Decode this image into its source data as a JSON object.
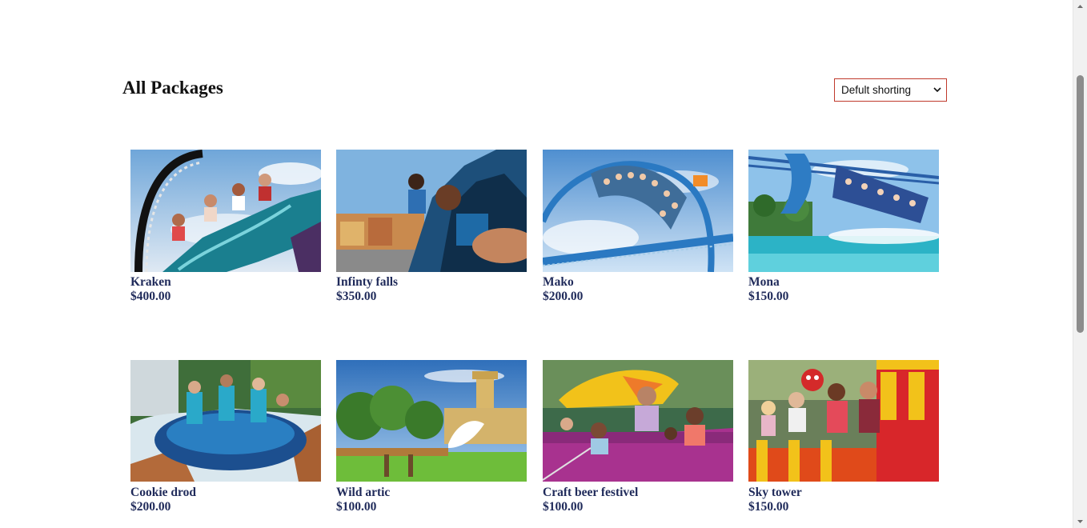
{
  "page": {
    "title": "All Packages"
  },
  "sort": {
    "selected": "Defult shorting"
  },
  "packages": [
    {
      "name": "Kraken",
      "price": "$400.00",
      "image": "roller-coaster-riders-photo"
    },
    {
      "name": "Infinty falls",
      "price": "$350.00",
      "image": "ride-close-up-photo"
    },
    {
      "name": "Mako",
      "price": "$200.00",
      "image": "blue-coaster-loop-photo"
    },
    {
      "name": "Mona",
      "price": "$150.00",
      "image": "coaster-over-water-photo"
    },
    {
      "name": "Cookie drod",
      "price": "$200.00",
      "image": "river-raft-photo"
    },
    {
      "name": "Wild artic",
      "price": "$100.00",
      "image": "water-splash-castle-photo"
    },
    {
      "name": "Craft beer festivel",
      "price": "$100.00",
      "image": "family-ride-photo"
    },
    {
      "name": "Sky tower",
      "price": "$150.00",
      "image": "kids-train-ride-photo"
    }
  ],
  "colors": {
    "text_dark": "#1f2a5a",
    "select_border": "#c0392b"
  }
}
